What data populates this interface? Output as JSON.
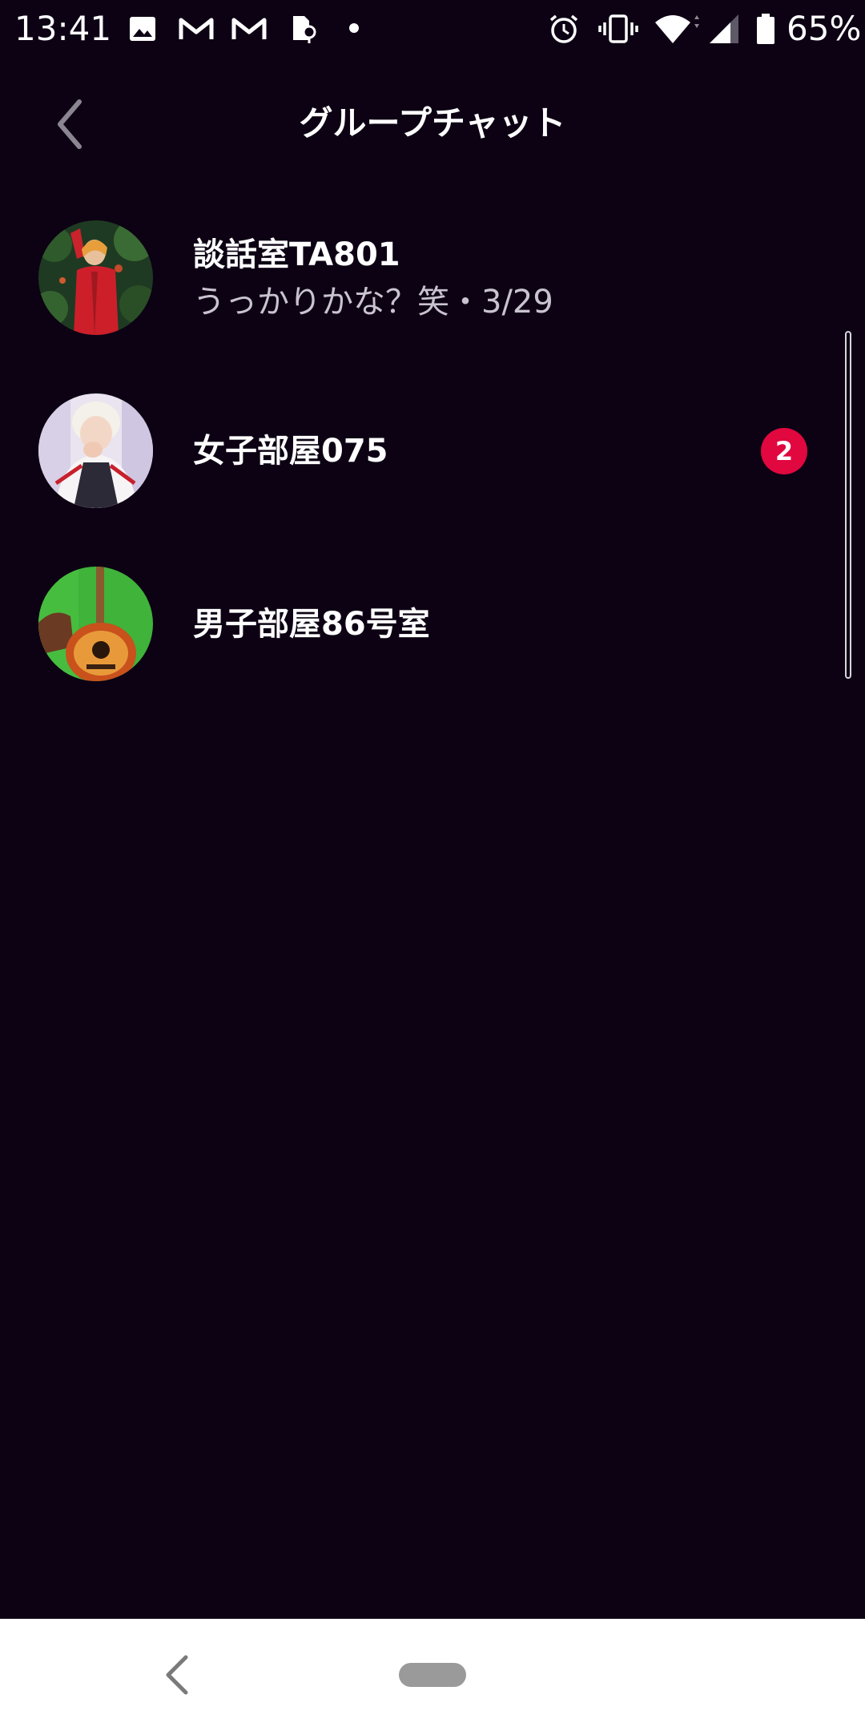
{
  "status_bar": {
    "time": "13:41",
    "battery": "65%",
    "icons": [
      "image-icon",
      "gmail-icon",
      "gmail-icon",
      "location-sim-icon",
      "notification-dot",
      "alarm-icon",
      "vibrate-icon",
      "wifi-icon",
      "signal-icon",
      "battery-icon"
    ]
  },
  "header": {
    "back_icon": "chevron-left-icon",
    "title": "グループチャット"
  },
  "chats": [
    {
      "name": "談話室TA801",
      "preview": "うっかりかな？笑・3/29",
      "unread": "",
      "avatar": "person-red-jacket-foliage"
    },
    {
      "name": "女子部屋075",
      "preview": "",
      "unread": "2",
      "avatar": "person-track-jacket"
    },
    {
      "name": "男子部屋86号室",
      "preview": "",
      "unread": "",
      "avatar": "acoustic-guitar-green"
    }
  ],
  "colors": {
    "background": "#0d0214",
    "badge": "#e0083f",
    "text_primary": "#ffffff",
    "text_secondary": "#c9c3cf",
    "nav_bar": "#ffffff"
  },
  "nav_bar": {
    "back_icon": "nav-back-icon",
    "home_icon": "home-pill-icon"
  }
}
